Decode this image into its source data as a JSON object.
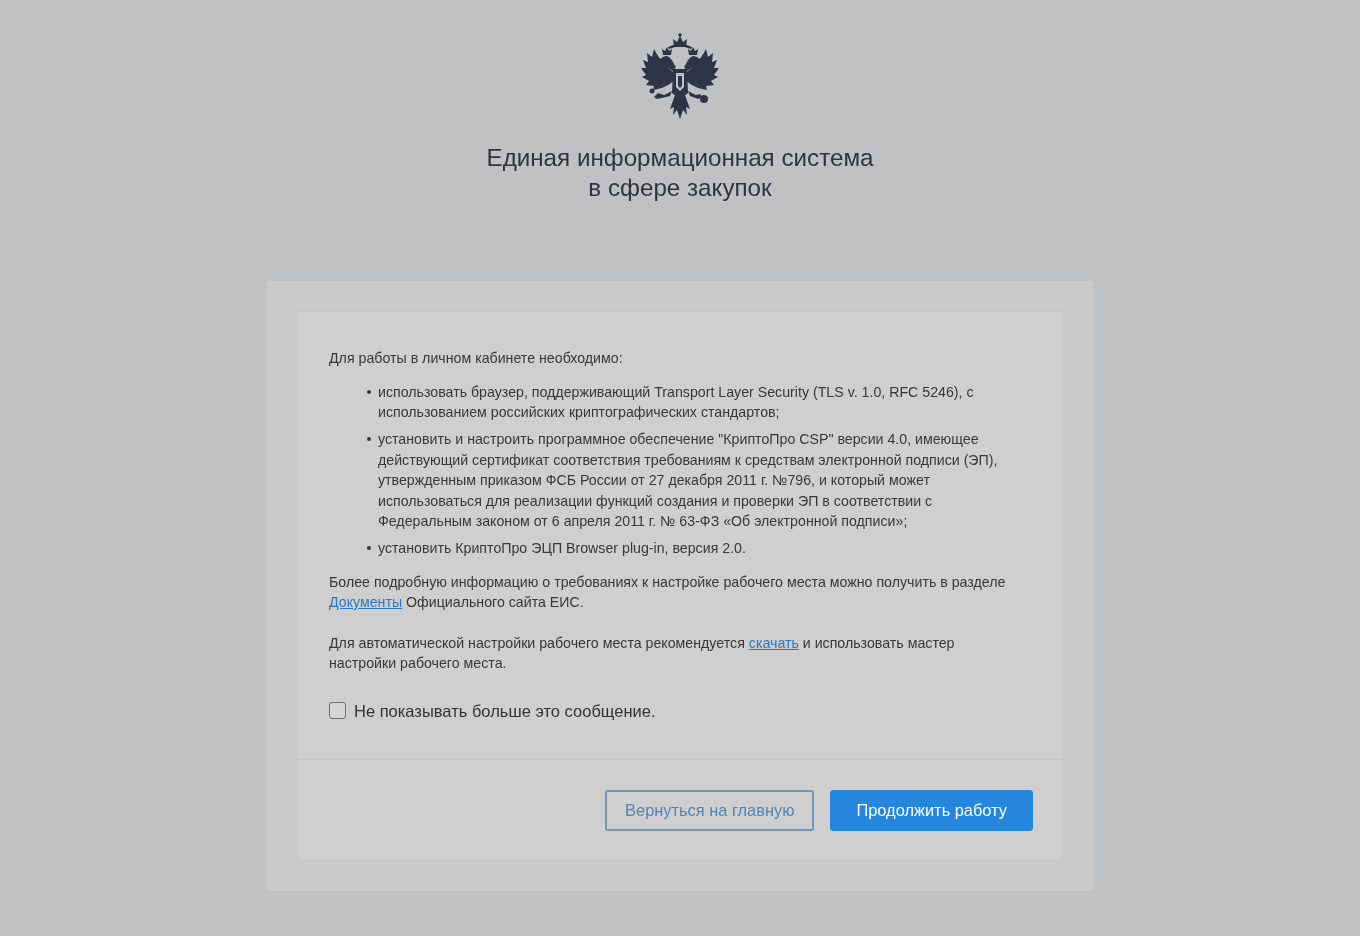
{
  "header": {
    "title_lines": [
      "Единая информационная система",
      "в сфере закупок"
    ]
  },
  "dialog": {
    "intro": "Для работы в личном кабинете необходимо:",
    "requirements": [
      "использовать браузер, поддерживающий Transport Layer Security (TLS v. 1.0, RFC 5246), с использованием российских криптографических стандартов;",
      "установить и настроить программное обеспечение \"КриптоПро CSP\" версии 4.0, имеющее действующий сертификат соответствия требованиям к средствам электронной подписи (ЭП), утвержденным приказом ФСБ России от 27 декабря 2011 г. №796, и который может использоваться для реализации функций создания и проверки ЭП в соответствии с Федеральным законом от 6 апреля 2011 г. № 63-ФЗ «Об электронной подписи»;",
      "установить КриптоПро ЭЦП Browser plug-in, версия 2.0."
    ],
    "paragraphs": [
      {
        "before": "Более подробную информацию о требованиях к настройке рабочего места можно получить в разделе ",
        "link": "Документы",
        "after": " Официального сайта ЕИС."
      },
      {
        "before": "Для автоматической настройки рабочего места рекомендуется ",
        "link": "скачать",
        "after": " и использовать мастер настройки рабочего места."
      }
    ],
    "dont_show_again": {
      "label": "Не показывать больше это сообщение.",
      "checked": false
    },
    "buttons": [
      {
        "label": "Вернуться на главную",
        "kind": "secondary"
      },
      {
        "label": "Продолжить работу",
        "kind": "primary"
      }
    ]
  }
}
